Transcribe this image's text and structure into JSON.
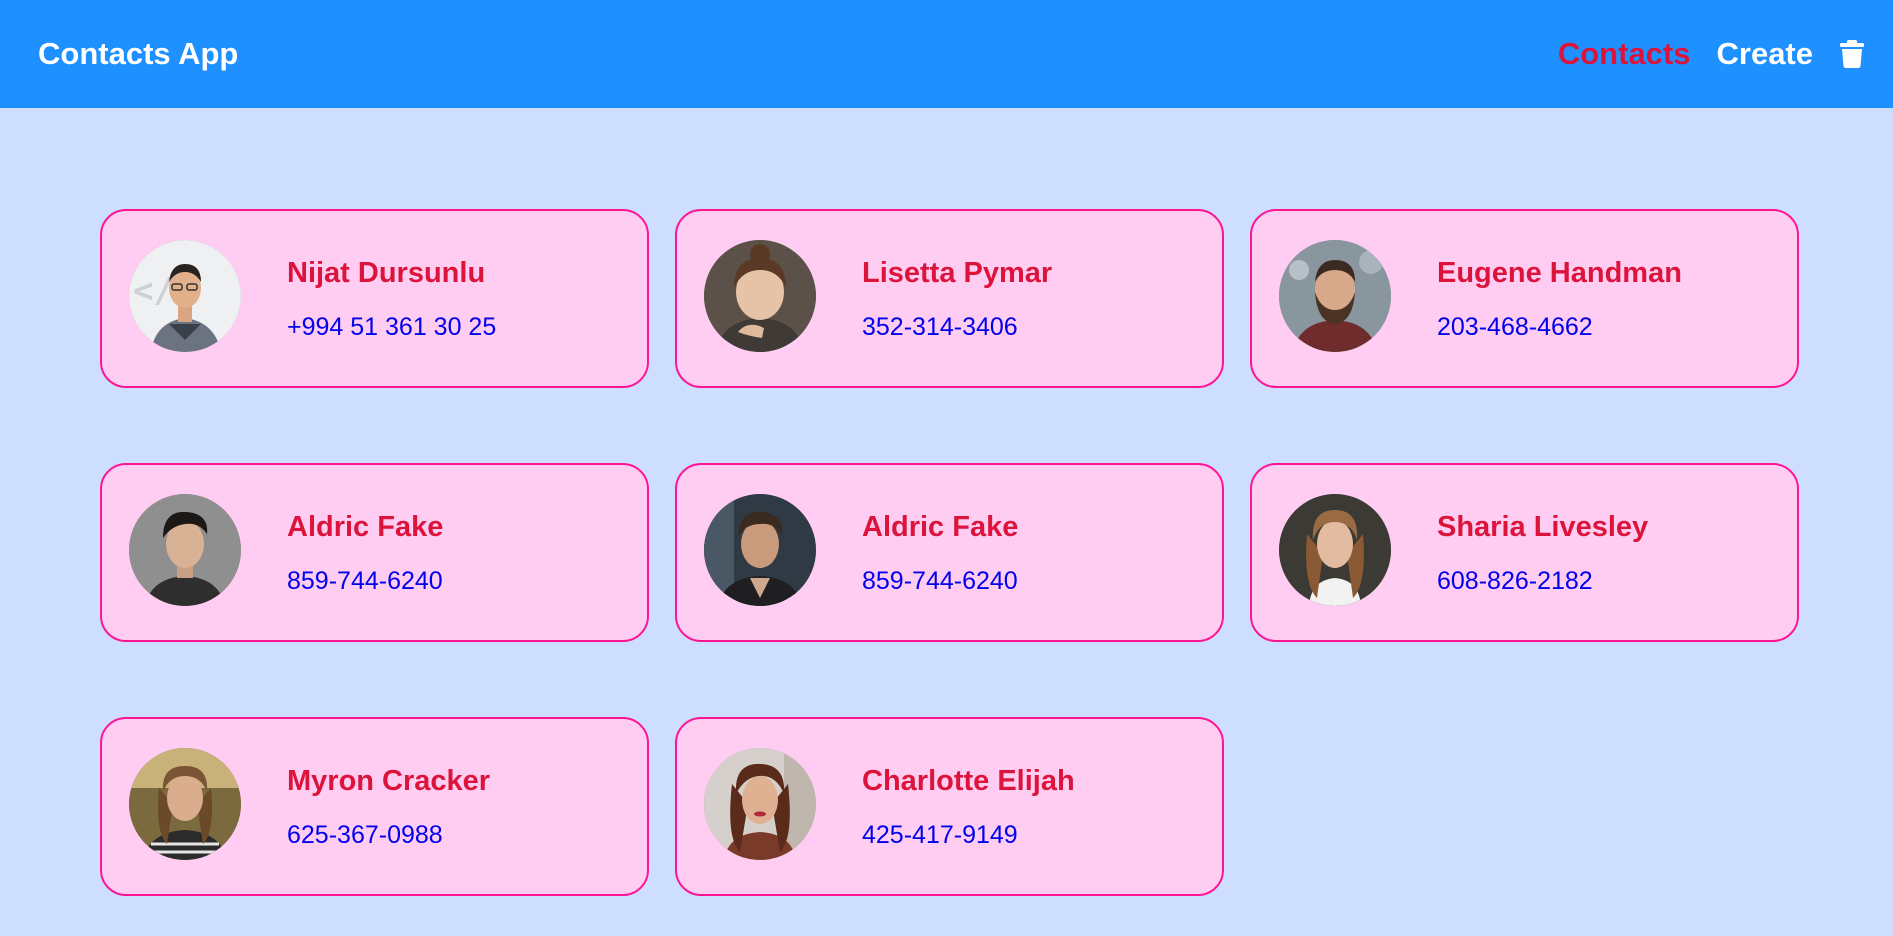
{
  "app": {
    "title": "Contacts App"
  },
  "nav": {
    "contacts_label": "Contacts",
    "create_label": "Create",
    "delete_icon": "trash-icon"
  },
  "colors": {
    "navbar": "#1e90ff",
    "background": "#cddeff",
    "card_background": "#ffccf2",
    "card_border": "#ff1493",
    "name_text": "#dc143c",
    "phone_text": "#0000ee",
    "active_link": "#dc143c"
  },
  "contacts": [
    {
      "name": "Nijat Dursunlu",
      "phone": "+994 51 361 30 25",
      "avatar": "profile-photo"
    },
    {
      "name": "Lisetta Pymar",
      "phone": "352-314-3406",
      "avatar": "profile-photo"
    },
    {
      "name": "Eugene Handman",
      "phone": "203-468-4662",
      "avatar": "profile-photo"
    },
    {
      "name": "Aldric Fake",
      "phone": "859-744-6240",
      "avatar": "profile-photo"
    },
    {
      "name": "Aldric Fake",
      "phone": "859-744-6240",
      "avatar": "profile-photo"
    },
    {
      "name": "Sharia Livesley",
      "phone": "608-826-2182",
      "avatar": "profile-photo"
    },
    {
      "name": "Myron Cracker",
      "phone": "625-367-0988",
      "avatar": "profile-photo"
    },
    {
      "name": "Charlotte Elijah",
      "phone": "425-417-9149",
      "avatar": "profile-photo"
    }
  ]
}
